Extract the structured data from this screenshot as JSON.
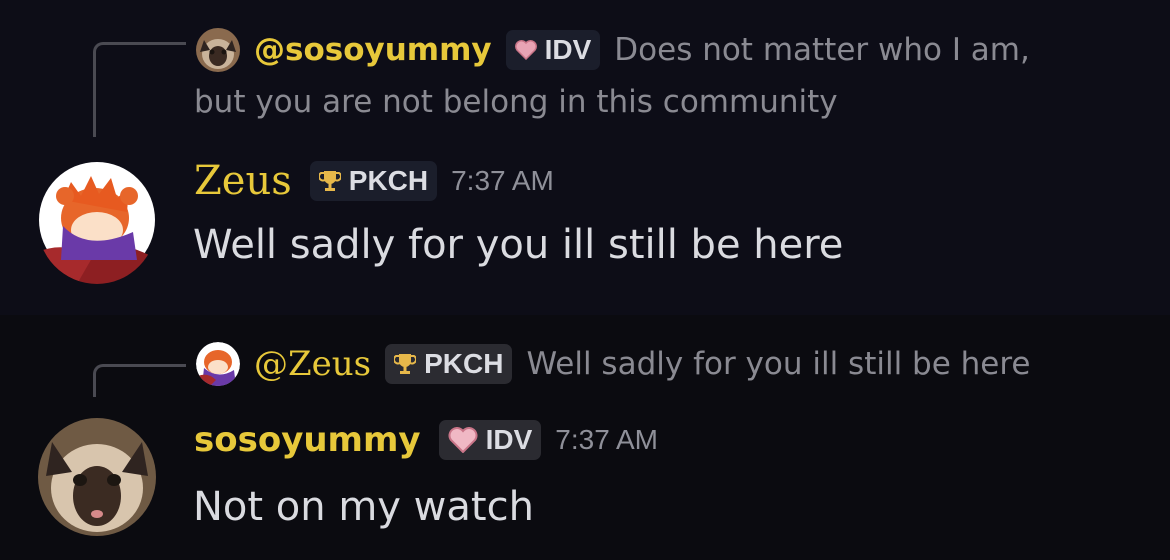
{
  "messages": [
    {
      "reply": {
        "mention": "@sosoyummy",
        "tag_label": "IDV",
        "tag_icon": "heart-icon",
        "text_line1": "Does not matter who I am,",
        "text_line2": "but you are not belong in this community"
      },
      "author": "Zeus",
      "author_color": "#e7c83a",
      "tag_label": "PKCH",
      "tag_icon": "trophy-icon",
      "timestamp": "7:37 AM",
      "content": "Well sadly for you ill still be here"
    },
    {
      "reply": {
        "mention": "@Zeus",
        "tag_label": "PKCH",
        "tag_icon": "trophy-icon",
        "text_line1": "Well sadly for you ill still be here"
      },
      "author": "sosoyummy",
      "author_color": "#e7c83a",
      "tag_label": "IDV",
      "tag_icon": "heart-icon",
      "timestamp": "7:37 AM",
      "content": "Not on my watch"
    }
  ],
  "colors": {
    "background": "#0d0d17",
    "username": "#e7c83a",
    "tag_bg": "#1b1e2b",
    "text": "#dadbe0",
    "muted": "#8a8a92"
  }
}
